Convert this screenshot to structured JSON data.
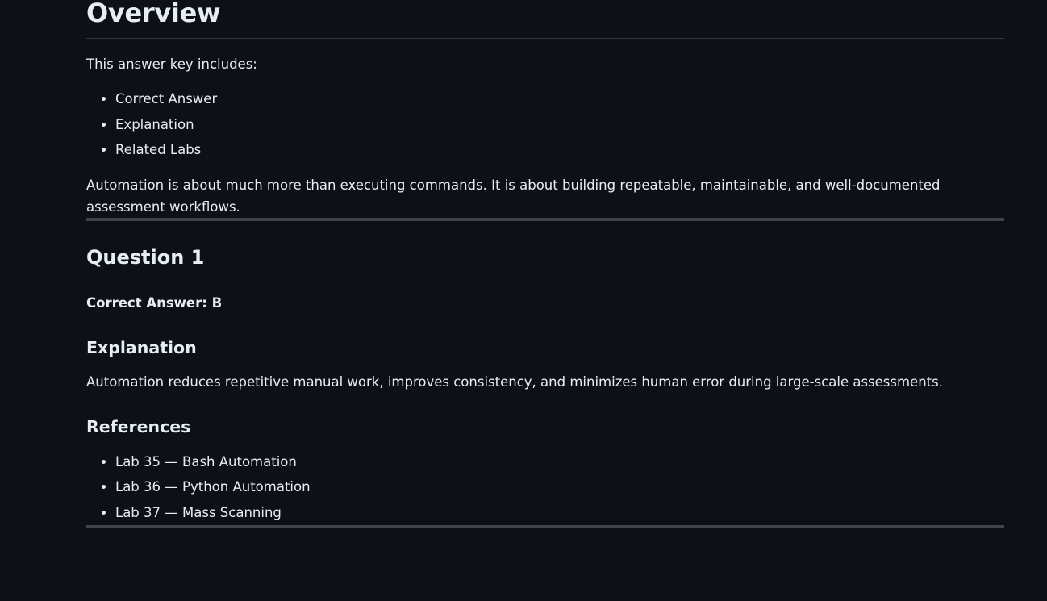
{
  "overview": {
    "title": "Overview",
    "intro": "This answer key includes:",
    "items": [
      "Correct Answer",
      "Explanation",
      "Related Labs"
    ],
    "summary": "Automation is about much more than executing commands. It is about building repeatable, maintainable, and well-documented assessment workflows."
  },
  "question1": {
    "title": "Question 1",
    "correct_answer": "Correct Answer: B",
    "explanation_heading": "Explanation",
    "explanation": "Automation reduces repetitive manual work, improves consistency, and minimizes human error during large-scale assessments.",
    "references_heading": "References",
    "references": [
      "Lab 35 — Bash Automation",
      "Lab 36 — Python Automation",
      "Lab 37 — Mass Scanning"
    ]
  },
  "colors": {
    "background": "#0d1117",
    "text": "#e6edf3",
    "divider": "#3d444d"
  }
}
